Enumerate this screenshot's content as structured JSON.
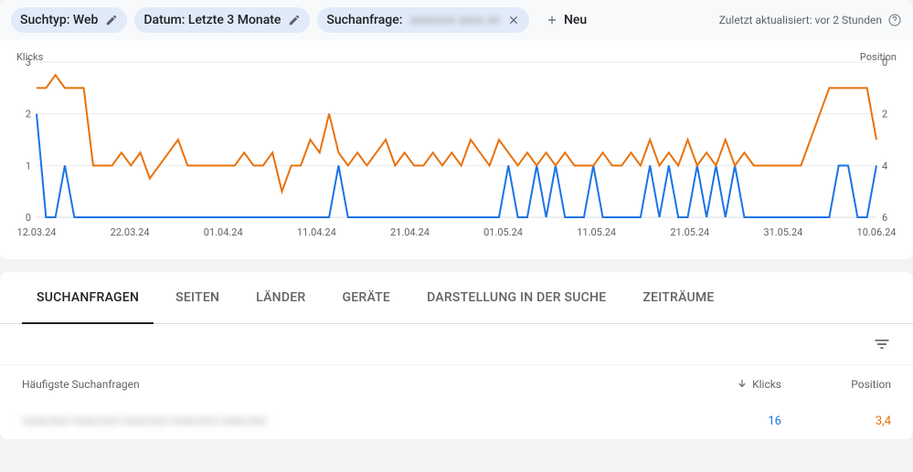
{
  "chips": [
    {
      "label": "Suchtyp: Web",
      "type": "edit"
    },
    {
      "label": "Datum: Letzte 3 Monate",
      "type": "edit"
    },
    {
      "label": "Suchanfrage:",
      "type": "close",
      "obscured": true
    }
  ],
  "add_new": "Neu",
  "updated_text": "Zuletzt aktualisiert: vor 2 Stunden",
  "chart_data": {
    "type": "line",
    "left_axis_label": "Klicks",
    "right_axis_label": "Position",
    "ylim_left": [
      0,
      3
    ],
    "yticks_left": [
      0,
      1,
      2,
      3
    ],
    "ylim_right_inverted": [
      6,
      0
    ],
    "yticks_right": [
      0,
      2,
      4,
      6
    ],
    "x_categories": [
      "12.03.24",
      "22.03.24",
      "01.04.24",
      "11.04.24",
      "21.04.24",
      "01.05.24",
      "11.05.24",
      "21.05.24",
      "31.05.24",
      "10.06.24"
    ],
    "series": [
      {
        "name": "Klicks",
        "color": "#1a73e8",
        "axis": "left",
        "values": [
          2,
          0,
          0,
          1,
          0,
          0,
          0,
          0,
          0,
          0,
          0,
          0,
          0,
          0,
          0,
          0,
          0,
          0,
          0,
          0,
          0,
          0,
          0,
          0,
          0,
          0,
          0,
          0,
          0,
          0,
          0,
          0,
          1,
          0,
          0,
          0,
          0,
          0,
          0,
          0,
          0,
          0,
          0,
          0,
          0,
          0,
          0,
          0,
          0,
          0,
          1,
          0,
          0,
          1,
          0,
          1,
          0,
          0,
          0,
          1,
          0,
          0,
          0,
          0,
          0,
          1,
          0,
          1,
          0,
          0,
          1,
          0,
          1,
          0,
          1,
          0,
          0,
          0,
          0,
          0,
          0,
          0,
          0,
          0,
          0,
          1,
          1,
          0,
          0,
          1
        ]
      },
      {
        "name": "Position",
        "color": "#e8710a",
        "axis": "right",
        "values": [
          1.0,
          1.0,
          0.5,
          1.0,
          1.0,
          1.0,
          4.0,
          4.0,
          4.0,
          3.5,
          4.0,
          3.5,
          4.5,
          4.0,
          3.5,
          3.0,
          4.0,
          4.0,
          4.0,
          4.0,
          4.0,
          4.0,
          3.5,
          4.0,
          4.0,
          3.5,
          5.0,
          4.0,
          4.0,
          3.0,
          3.5,
          2.0,
          3.5,
          4.0,
          3.5,
          4.0,
          3.5,
          3.0,
          4.0,
          3.5,
          4.0,
          4.0,
          3.5,
          4.0,
          3.5,
          4.0,
          3.0,
          3.5,
          4.0,
          3.0,
          3.5,
          4.0,
          3.5,
          4.0,
          3.5,
          4.0,
          3.5,
          4.0,
          4.0,
          4.0,
          3.5,
          4.0,
          4.0,
          3.5,
          4.0,
          3.0,
          4.0,
          3.5,
          4.0,
          3.0,
          4.0,
          3.5,
          4.0,
          3.0,
          4.0,
          3.5,
          4.0,
          4.0,
          4.0,
          4.0,
          4.0,
          4.0,
          3.0,
          2.0,
          1.0,
          1.0,
          1.0,
          1.0,
          1.0,
          3.0
        ]
      }
    ]
  },
  "tabs": [
    "SUCHANFRAGEN",
    "SEITEN",
    "LÄNDER",
    "GERÄTE",
    "DARSTELLUNG IN DER SUCHE",
    "ZEITRÄUME"
  ],
  "active_tab": 0,
  "table": {
    "columns": {
      "query": "Häufigste Suchanfragen",
      "klicks": "Klicks",
      "position": "Position"
    },
    "rows": [
      {
        "query": "redacted redacted redacted redacted redacted",
        "klicks": "16",
        "position": "3,4"
      }
    ]
  }
}
